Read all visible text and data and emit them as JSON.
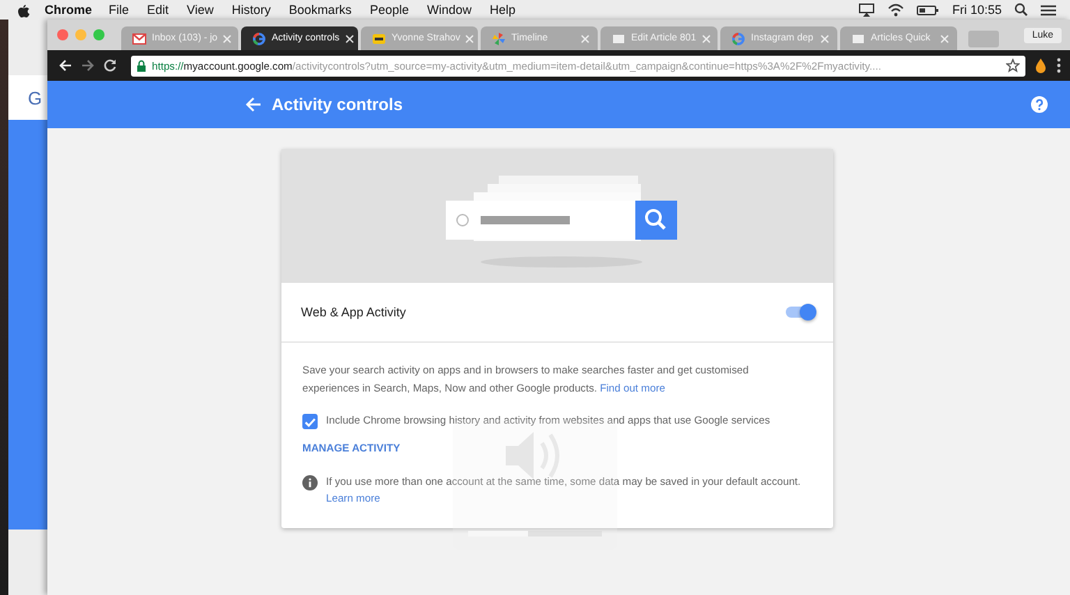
{
  "menu_bar": {
    "app": "Chrome",
    "menus": [
      "File",
      "Edit",
      "View",
      "History",
      "Bookmarks",
      "People",
      "Window",
      "Help"
    ],
    "clock": "Fri 10:55"
  },
  "background_window": {
    "logo": "G"
  },
  "browser": {
    "tabs": [
      {
        "title": "Inbox (103) - jo",
        "kind": "mail",
        "selected": false
      },
      {
        "title": "Activity controls",
        "kind": "google",
        "selected": true
      },
      {
        "title": "Yvonne Strahov",
        "kind": "badge",
        "selected": false
      },
      {
        "title": "Timeline",
        "kind": "pinwheel",
        "selected": false
      },
      {
        "title": "Edit Article 801",
        "kind": "page",
        "selected": false
      },
      {
        "title": "Instagram dep",
        "kind": "google",
        "selected": false
      },
      {
        "title": "Articles Quick",
        "kind": "page",
        "selected": false
      }
    ],
    "profile": "Luke",
    "address": {
      "scheme": "https://",
      "host": "myaccount.google.com",
      "path": "/activitycontrols?utm_source=my-activity&utm_medium=item-detail&utm_campaign&continue=https%3A%2F%2Fmyactivity...."
    }
  },
  "page": {
    "title": "Activity controls",
    "card": {
      "setting": {
        "label": "Web & App Activity",
        "on": true
      },
      "description": "Save your search activity on apps and in browsers to make searches faster and get customised experiences in Search, Maps, Now and other Google products.",
      "description_link": "Find out more",
      "checkbox": {
        "label": "Include Chrome browsing history and activity from websites and apps that use Google services",
        "checked": true
      },
      "manage_link": "MANAGE ACTIVITY",
      "info": "If you use more than one account at the same time, some data may be saved in your default account.",
      "info_link": "Learn more"
    }
  },
  "volume_overlay": {
    "level": 0.45
  }
}
